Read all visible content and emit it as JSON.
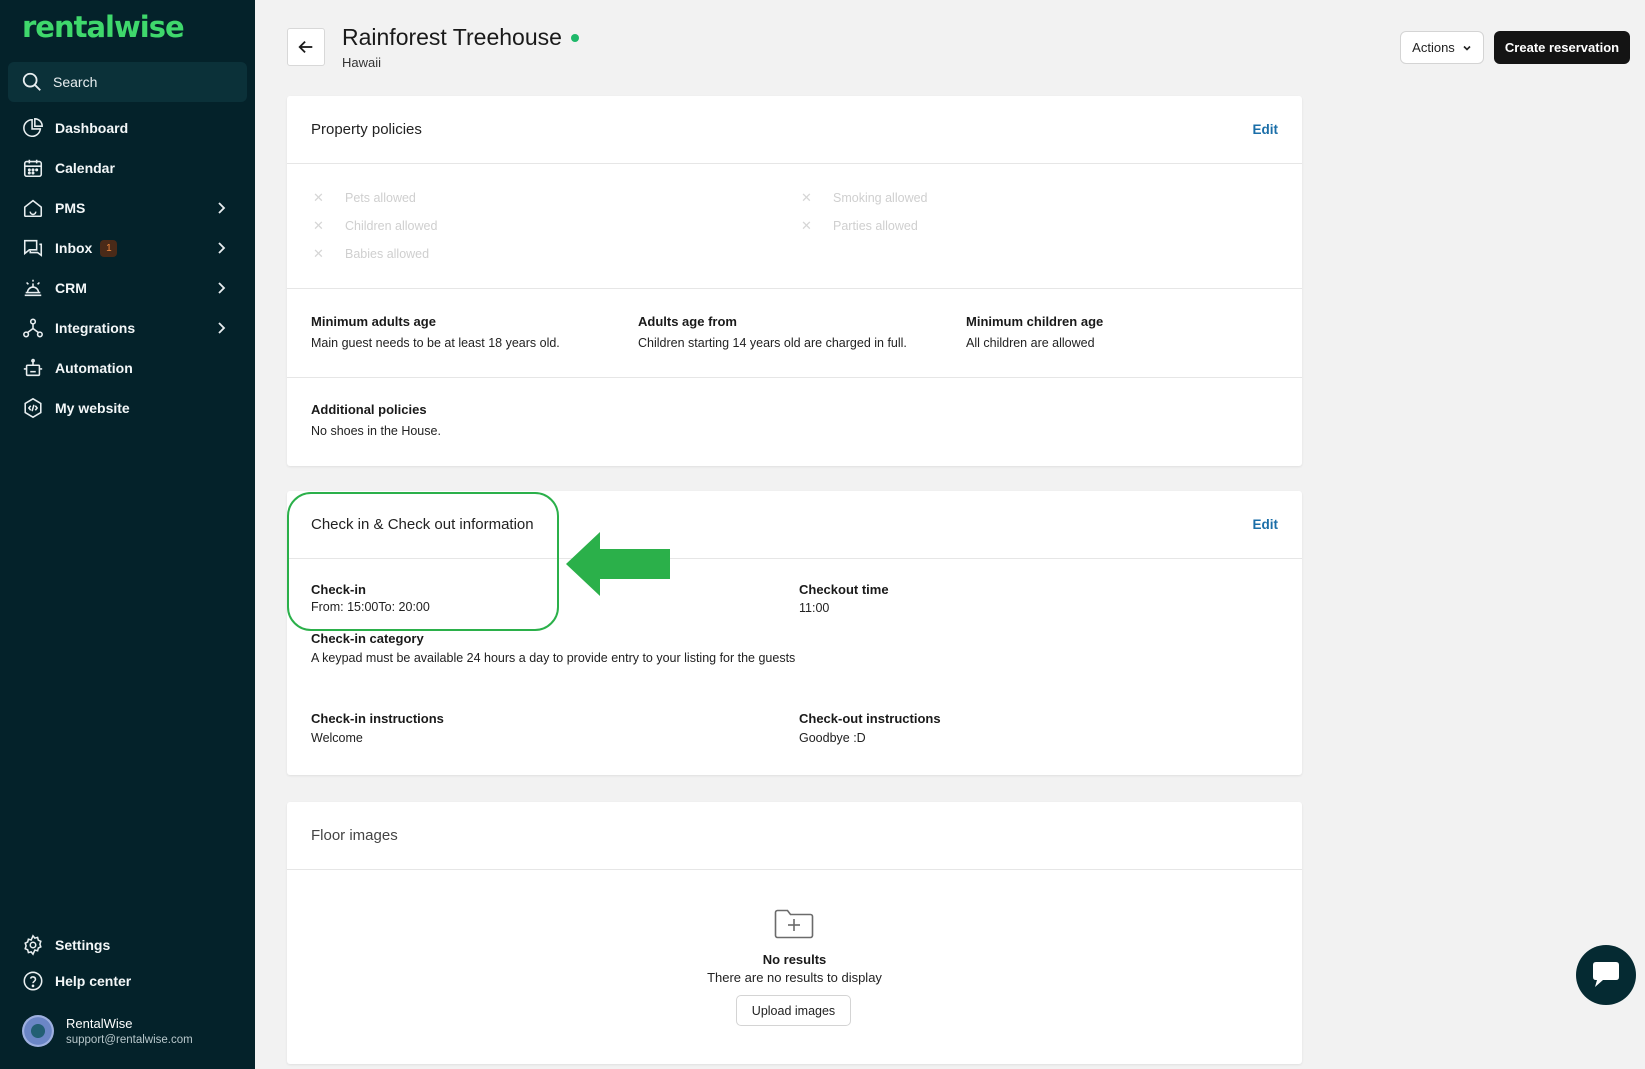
{
  "brand": {
    "logo_text": "rentalwise",
    "logo_color": "#3fd86c",
    "sidebar_bg": "#04222a"
  },
  "search": {
    "label": "Search"
  },
  "nav": {
    "items": [
      {
        "label": "Dashboard",
        "icon": "pie-chart-icon"
      },
      {
        "label": "Calendar",
        "icon": "calendar-icon"
      },
      {
        "label": "PMS",
        "icon": "house-icon",
        "has_chevron": true
      },
      {
        "label": "Inbox",
        "icon": "inbox-icon",
        "badge": "1",
        "has_chevron": true
      },
      {
        "label": "CRM",
        "icon": "bell-icon",
        "has_chevron": true
      },
      {
        "label": "Integrations",
        "icon": "integrations-icon",
        "has_chevron": true
      },
      {
        "label": "Automation",
        "icon": "robot-icon"
      },
      {
        "label": "My website",
        "icon": "code-icon"
      }
    ],
    "bottom": [
      {
        "label": "Settings",
        "icon": "gear-icon"
      },
      {
        "label": "Help center",
        "icon": "help-icon"
      }
    ]
  },
  "user": {
    "name": "RentalWise",
    "email": "support@rentalwise.com"
  },
  "header": {
    "title": "Rainforest Treehouse",
    "subtitle": "Hawaii",
    "status_color": "#1fb86a",
    "actions_label": "Actions",
    "create_label": "Create reservation"
  },
  "policies": {
    "title": "Property policies",
    "edit_label": "Edit",
    "toggles": [
      "Pets allowed",
      "Children allowed",
      "Babies allowed",
      "Smoking allowed",
      "Parties allowed"
    ],
    "min_adults": {
      "label": "Minimum adults age",
      "value": "Main guest needs to be at least 18 years old."
    },
    "adults_from": {
      "label": "Adults age from",
      "value": "Children starting 14 years old are charged in full."
    },
    "min_children": {
      "label": "Minimum children age",
      "value": "All children are allowed"
    },
    "additional": {
      "label": "Additional policies",
      "value": "No shoes in the House."
    }
  },
  "checkin": {
    "title": "Check in & Check out information",
    "edit_label": "Edit",
    "checkin": {
      "label": "Check-in",
      "value": "From: 15:00To: 20:00"
    },
    "checkout": {
      "label": "Checkout time",
      "value": "11:00"
    },
    "category": {
      "label": "Check-in category",
      "value": "A keypad must be available 24 hours a day to provide entry to your listing for the guests"
    },
    "ci_instructions": {
      "label": "Check-in instructions",
      "value": "Welcome"
    },
    "co_instructions": {
      "label": "Check-out instructions",
      "value": "Goodbye :D"
    }
  },
  "floor": {
    "title": "Floor images",
    "no_results_title": "No results",
    "no_results_sub": "There are no results to display",
    "upload_label": "Upload images"
  },
  "annotation": {
    "color": "#2bb04a"
  }
}
